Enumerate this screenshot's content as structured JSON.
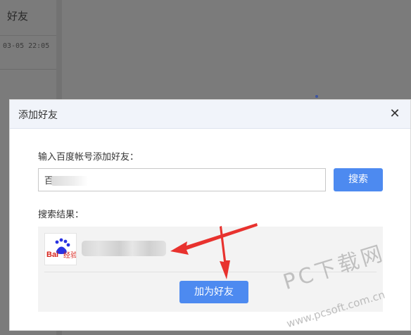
{
  "background": {
    "title": "好友",
    "timestamp": "03-05 22:05"
  },
  "dialog": {
    "title": "添加好友",
    "close_label": "✕",
    "input_label": "输入百度帐号添加好友：",
    "input_value": "百",
    "search_label": "搜索",
    "results_label": "搜索结果：",
    "result_avatar_text": "Bai经验",
    "add_friend_label": "加为好友"
  },
  "watermark": {
    "brand": "PC下载网",
    "url": "www.pcsoft.com.cn"
  },
  "colors": {
    "accent": "#4d8af0",
    "overlay": "#7b7b7b",
    "header": "#f1f4fa",
    "arrow": "#e8322e",
    "baidu_red": "#d7241c",
    "baidu_blue": "#2932e1"
  }
}
